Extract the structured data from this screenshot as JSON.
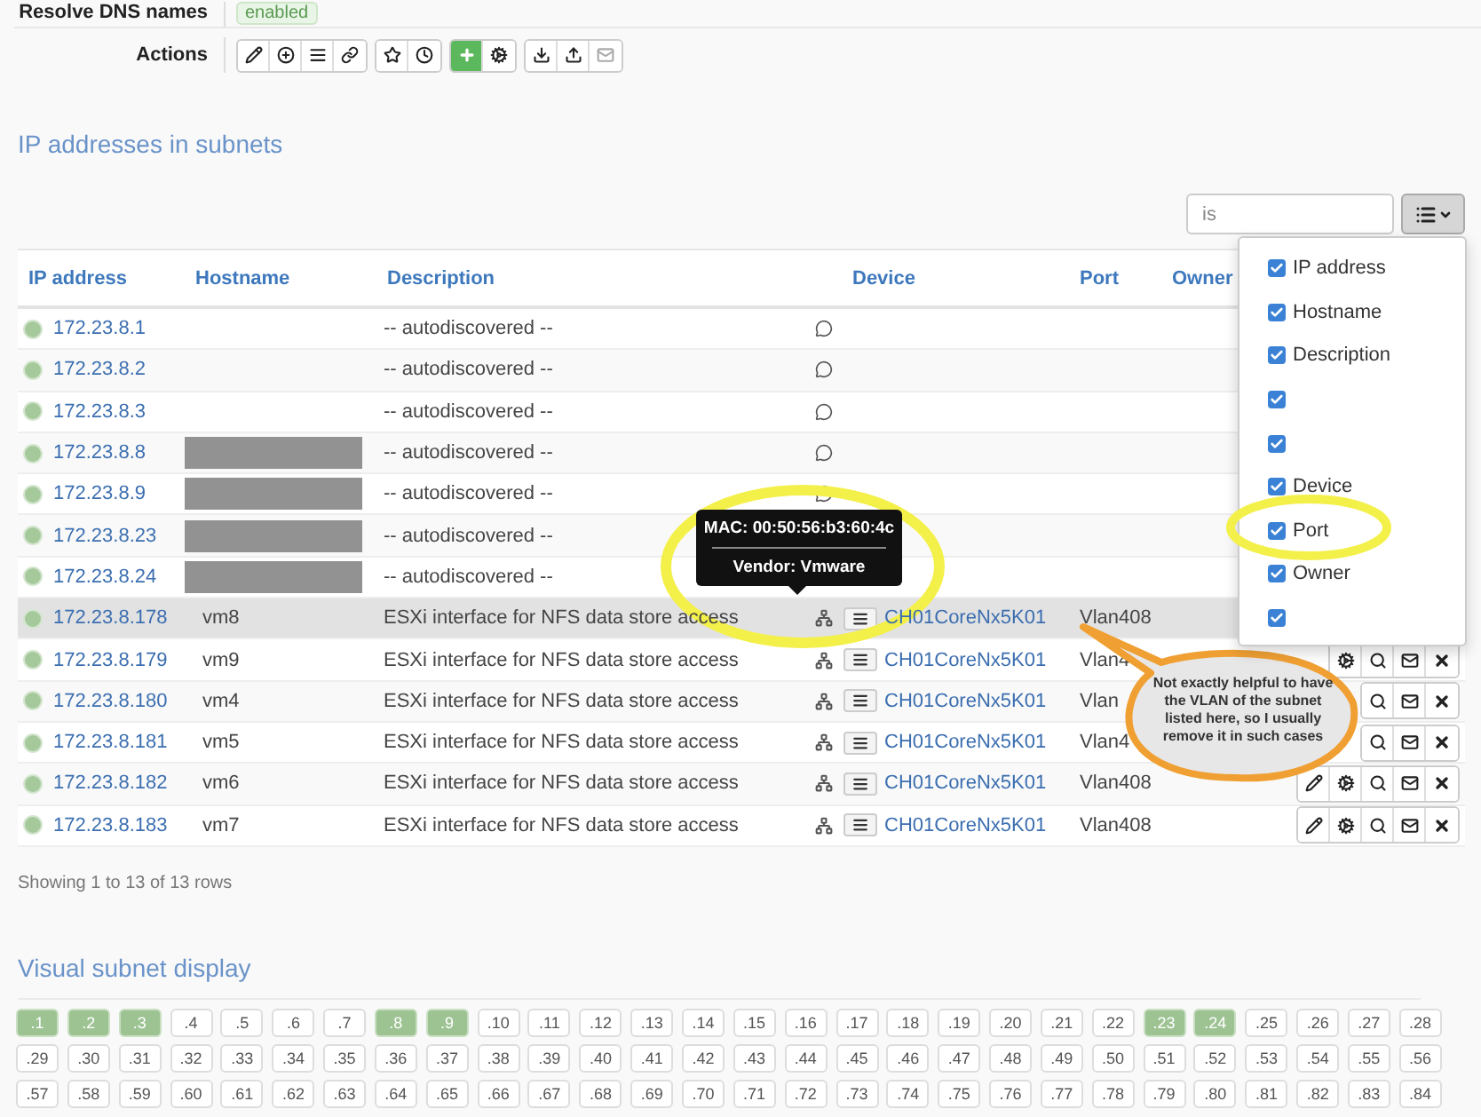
{
  "settings": [
    {
      "label": "Resolve DNS names",
      "value": "enabled"
    }
  ],
  "actions": {
    "label": "Actions",
    "groups": [
      [
        {
          "kind": "edit"
        },
        {
          "kind": "add-circle"
        },
        {
          "kind": "list"
        },
        {
          "kind": "link"
        }
      ],
      [
        {
          "kind": "star"
        },
        {
          "kind": "clock"
        }
      ],
      [
        {
          "kind": "add",
          "primary": true
        },
        {
          "kind": "gears"
        }
      ],
      [
        {
          "kind": "download"
        },
        {
          "kind": "upload"
        },
        {
          "kind": "mail",
          "disabled": true
        }
      ]
    ]
  },
  "section_title": "IP addresses in subnets",
  "search": {
    "value": "is"
  },
  "columns": [
    {
      "label": "IP address"
    },
    {
      "label": "Hostname"
    },
    {
      "label": "Description"
    },
    {},
    {
      "label": "Device"
    },
    {
      "label": "Port"
    },
    {
      "label": "Owner"
    },
    {}
  ],
  "rows": [
    {
      "kind": "discovered",
      "ip": "172.23.8.1",
      "description": "-- autodiscovered --",
      "note_icon": true
    },
    {
      "kind": "discovered",
      "ip": "172.23.8.2",
      "description": "-- autodiscovered --",
      "note_icon": true
    },
    {
      "kind": "discovered",
      "ip": "172.23.8.3",
      "description": "-- autodiscovered --",
      "note_icon": true
    },
    {
      "kind": "discovered",
      "ip": "172.23.8.8",
      "redacted": true,
      "description": "-- autodiscovered --",
      "note_icon": true
    },
    {
      "kind": "discovered",
      "ip": "172.23.8.9",
      "redacted": true,
      "description": "-- autodiscovered --",
      "note_icon": true
    },
    {
      "kind": "discovered",
      "ip": "172.23.8.23",
      "redacted": true,
      "description": "-- autodiscovered --",
      "note_icon": false
    },
    {
      "kind": "discovered",
      "ip": "172.23.8.24",
      "redacted": true,
      "description": "-- autodiscovered --",
      "note_icon": false
    },
    {
      "kind": "host",
      "ip": "172.23.8.178",
      "hostname": "vm8",
      "description": "ESXi interface for NFS data store access",
      "device": "CH01CoreNx5K01",
      "port": "Vlan408",
      "hovered": true
    },
    {
      "kind": "host",
      "ip": "172.23.8.179",
      "hostname": "vm9",
      "description": "ESXi interface for NFS data store access",
      "device": "CH01CoreNx5K01",
      "port": "Vlan4",
      "hovered": false,
      "actions": [
        {
          "kind": "gears"
        },
        {
          "kind": "search"
        },
        {
          "kind": "mail"
        },
        {
          "kind": "delete"
        }
      ]
    },
    {
      "kind": "host",
      "ip": "172.23.8.180",
      "hostname": "vm4",
      "description": "ESXi interface for NFS data store access",
      "device": "CH01CoreNx5K01",
      "port": "Vlan",
      "hovered": false,
      "actions": [
        {
          "kind": "search"
        },
        {
          "kind": "mail"
        },
        {
          "kind": "delete"
        }
      ]
    },
    {
      "kind": "host",
      "ip": "172.23.8.181",
      "hostname": "vm5",
      "description": "ESXi interface for NFS data store access",
      "device": "CH01CoreNx5K01",
      "port": "Vlan4",
      "hovered": false,
      "actions": [
        {
          "kind": "search"
        },
        {
          "kind": "mail"
        },
        {
          "kind": "delete"
        }
      ]
    },
    {
      "kind": "host",
      "ip": "172.23.8.182",
      "hostname": "vm6",
      "description": "ESXi interface for NFS data store access",
      "device": "CH01CoreNx5K01",
      "port": "Vlan408",
      "hovered": false,
      "actions": [
        {
          "kind": "edit"
        },
        {
          "kind": "gears"
        },
        {
          "kind": "search"
        },
        {
          "kind": "mail"
        },
        {
          "kind": "delete"
        }
      ]
    },
    {
      "kind": "host",
      "ip": "172.23.8.183",
      "hostname": "vm7",
      "description": "ESXi interface for NFS data store access",
      "device": "CH01CoreNx5K01",
      "port": "Vlan408",
      "hovered": false,
      "actions": [
        {
          "kind": "edit"
        },
        {
          "kind": "gears"
        },
        {
          "kind": "search"
        },
        {
          "kind": "mail"
        },
        {
          "kind": "delete"
        }
      ]
    }
  ],
  "columns_menu": {
    "items": [
      {
        "label": "IP address",
        "checked": true
      },
      {
        "label": "Hostname",
        "checked": true
      },
      {
        "label": "Description",
        "checked": true
      },
      {
        "checked": true
      },
      {
        "checked": true
      },
      {
        "label": "Device",
        "checked": true
      },
      {
        "label": "Port",
        "checked": true
      },
      {
        "label": "Owner",
        "checked": true
      },
      {
        "checked": true
      }
    ]
  },
  "tooltip": {
    "lines": [
      "MAC: 00:50:56:b3:60:4c",
      "Vendor: Vmware"
    ]
  },
  "callout": {
    "text": "Not exactly helpful to have the VLAN of the subnet listed here, so I usually remove it in such cases"
  },
  "footer": "Showing 1 to 13 of 13 rows",
  "visual": {
    "title": "Visual subnet display",
    "cells": [
      {
        "label": ".1",
        "used": true
      },
      {
        "label": ".2",
        "used": true
      },
      {
        "label": ".3",
        "used": true
      },
      {
        "label": ".4",
        "used": false
      },
      {
        "label": ".5",
        "used": false
      },
      {
        "label": ".6",
        "used": false
      },
      {
        "label": ".7",
        "used": false
      },
      {
        "label": ".8",
        "used": true
      },
      {
        "label": ".9",
        "used": true
      },
      {
        "label": ".10",
        "used": false
      },
      {
        "label": ".11",
        "used": false
      },
      {
        "label": ".12",
        "used": false
      },
      {
        "label": ".13",
        "used": false
      },
      {
        "label": ".14",
        "used": false
      },
      {
        "label": ".15",
        "used": false
      },
      {
        "label": ".16",
        "used": false
      },
      {
        "label": ".17",
        "used": false
      },
      {
        "label": ".18",
        "used": false
      },
      {
        "label": ".19",
        "used": false
      },
      {
        "label": ".20",
        "used": false
      },
      {
        "label": ".21",
        "used": false
      },
      {
        "label": ".22",
        "used": false
      },
      {
        "label": ".23",
        "used": true
      },
      {
        "label": ".24",
        "used": true
      },
      {
        "label": ".25",
        "used": false
      },
      {
        "label": ".26",
        "used": false
      },
      {
        "label": ".27",
        "used": false
      },
      {
        "label": ".28",
        "used": false
      },
      {
        "label": ".29",
        "used": false
      },
      {
        "label": ".30",
        "used": false
      },
      {
        "label": ".31",
        "used": false
      },
      {
        "label": ".32",
        "used": false
      },
      {
        "label": ".33",
        "used": false
      },
      {
        "label": ".34",
        "used": false
      },
      {
        "label": ".35",
        "used": false
      },
      {
        "label": ".36",
        "used": false
      },
      {
        "label": ".37",
        "used": false
      },
      {
        "label": ".38",
        "used": false
      },
      {
        "label": ".39",
        "used": false
      },
      {
        "label": ".40",
        "used": false
      },
      {
        "label": ".41",
        "used": false
      },
      {
        "label": ".42",
        "used": false
      },
      {
        "label": ".43",
        "used": false
      },
      {
        "label": ".44",
        "used": false
      },
      {
        "label": ".45",
        "used": false
      },
      {
        "label": ".46",
        "used": false
      },
      {
        "label": ".47",
        "used": false
      },
      {
        "label": ".48",
        "used": false
      },
      {
        "label": ".49",
        "used": false
      },
      {
        "label": ".50",
        "used": false
      },
      {
        "label": ".51",
        "used": false
      },
      {
        "label": ".52",
        "used": false
      },
      {
        "label": ".53",
        "used": false
      },
      {
        "label": ".54",
        "used": false
      },
      {
        "label": ".55",
        "used": false
      },
      {
        "label": ".56",
        "used": false
      },
      {
        "label": ".57",
        "used": false
      },
      {
        "label": ".58",
        "used": false
      },
      {
        "label": ".59",
        "used": false
      },
      {
        "label": ".60",
        "used": false
      },
      {
        "label": ".61",
        "used": false
      },
      {
        "label": ".62",
        "used": false
      },
      {
        "label": ".63",
        "used": false
      },
      {
        "label": ".64",
        "used": false
      },
      {
        "label": ".65",
        "used": false
      },
      {
        "label": ".66",
        "used": false
      },
      {
        "label": ".67",
        "used": false
      },
      {
        "label": ".68",
        "used": false
      },
      {
        "label": ".69",
        "used": false
      },
      {
        "label": ".70",
        "used": false
      },
      {
        "label": ".71",
        "used": false
      },
      {
        "label": ".72",
        "used": false
      },
      {
        "label": ".73",
        "used": false
      },
      {
        "label": ".74",
        "used": false
      },
      {
        "label": ".75",
        "used": false
      },
      {
        "label": ".76",
        "used": false
      },
      {
        "label": ".77",
        "used": false
      },
      {
        "label": ".78",
        "used": false
      },
      {
        "label": ".79",
        "used": false
      },
      {
        "label": ".80",
        "used": false
      },
      {
        "label": ".81",
        "used": false
      },
      {
        "label": ".82",
        "used": false
      },
      {
        "label": ".83",
        "used": false
      },
      {
        "label": ".84",
        "used": false
      }
    ]
  }
}
